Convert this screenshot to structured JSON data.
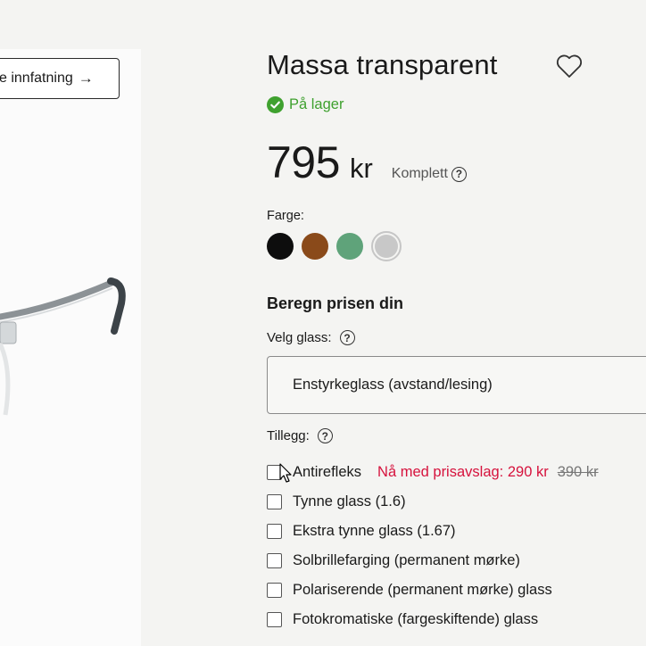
{
  "product_image": {
    "try_on_label": "e innfatning",
    "arrow": "→"
  },
  "product": {
    "title": "Massa transparent",
    "stock_status": "På lager",
    "price": "795",
    "currency": "kr",
    "price_note": "Komplett",
    "help_glyph": "?"
  },
  "colors": {
    "label": "Farge:",
    "swatches": [
      "#0d0d0d",
      "#8a4a1a",
      "#5fa37a",
      "#c8c8c8"
    ],
    "selected": "#c8c8c8"
  },
  "calculator": {
    "heading": "Beregn prisen din",
    "glass_label": "Velg glass:",
    "glass_value": "Enstyrkeglass (avstand/lesing)",
    "addons_label": "Tillegg:",
    "addons": [
      {
        "label": "Antirefleks",
        "sale": "Nå med prisavslag: 290 kr",
        "old_price": "390 kr"
      },
      {
        "label": "Tynne glass (1.6)"
      },
      {
        "label": "Ekstra tynne glass (1.67)"
      },
      {
        "label": "Solbrillefarging (permanent mørke)"
      },
      {
        "label": "Polariserende (permanent mørke) glass"
      },
      {
        "label": "Fotokromatiske (fargeskiftende) glass"
      }
    ]
  },
  "theme": {
    "in_stock": "#3fa12f",
    "sale": "#d6123d"
  }
}
